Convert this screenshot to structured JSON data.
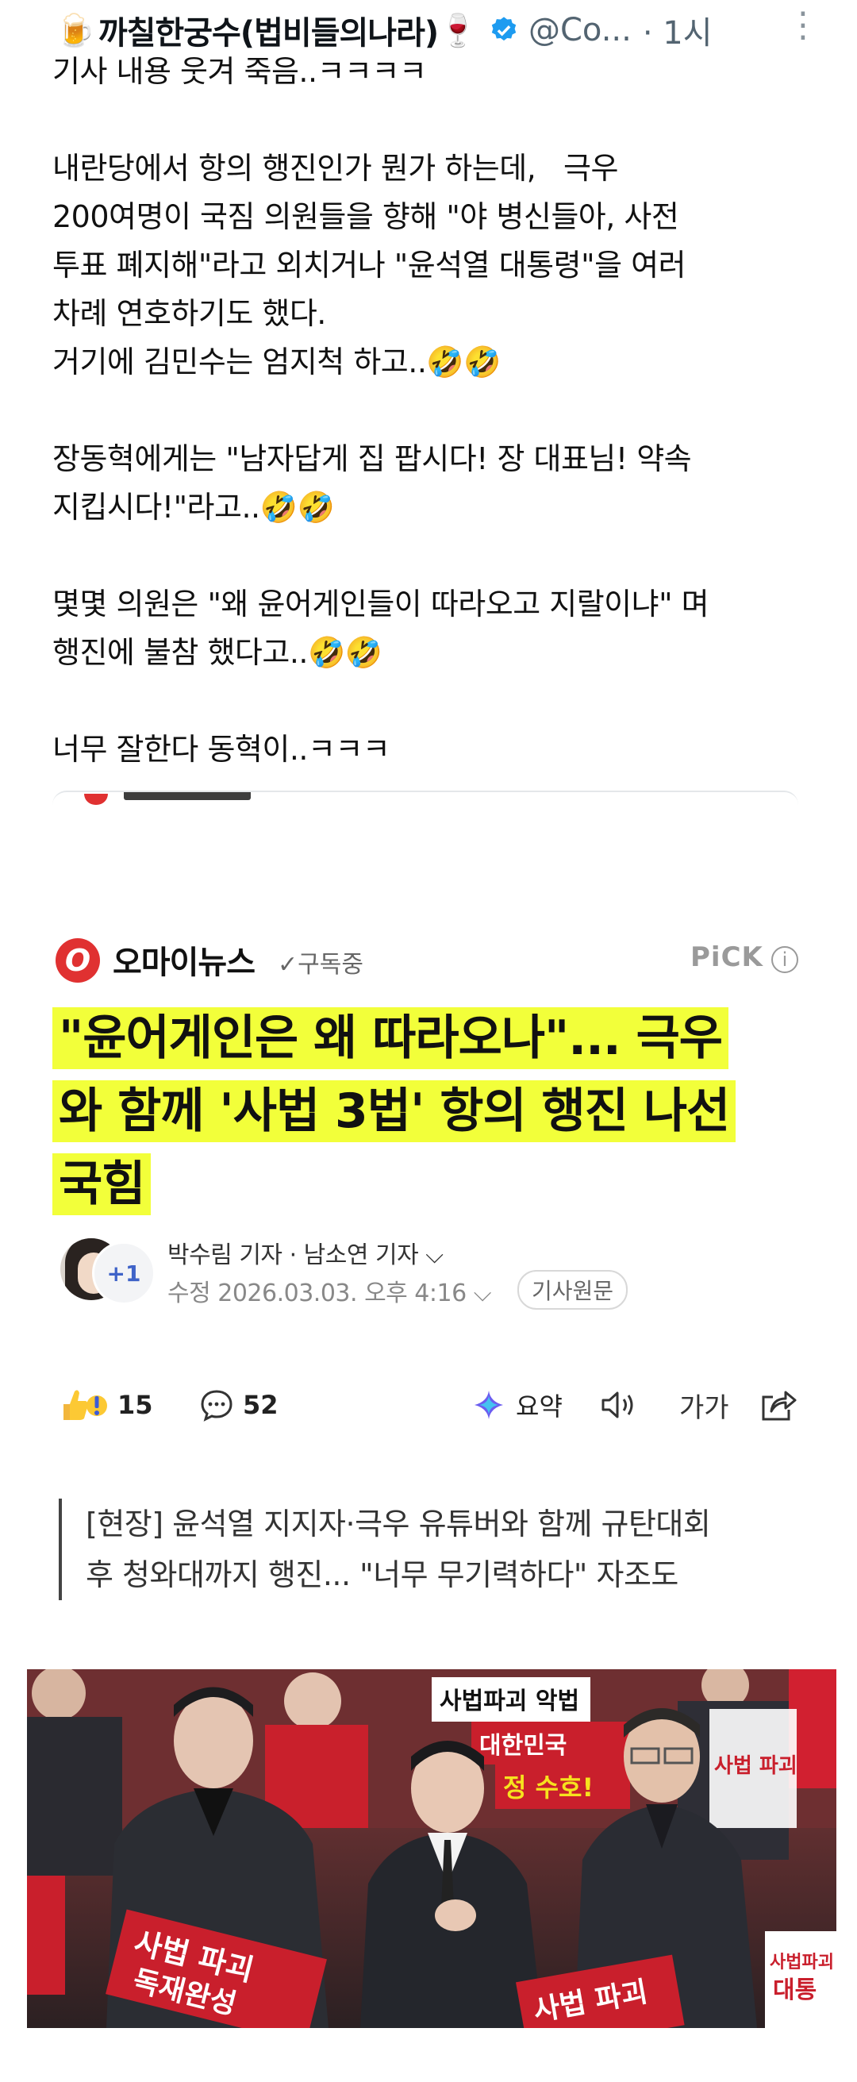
{
  "tweet": {
    "emoji_left": "🍺",
    "display_name": "까칠한궁수(법비들의나라)",
    "emoji_right": "🍷",
    "handle": "@Co...",
    "time": "· 1시",
    "more": "⋮",
    "body": [
      "기사 내용 웃겨 죽음..ㅋㅋㅋㅋ",
      "",
      "내란당에서 항의 행진인가 뭔가 하는데,   극우",
      "200여명이 국짐 의원들을 향해 \"야 병신들아, 사전",
      "투표 폐지해\"라고 외치거나 \"윤석열 대통령\"을 여러",
      "차례 연호하기도 했다.",
      "거기에 김민수는 엄지척 하고..🤣🤣",
      "",
      "장동혁에게는 \"남자답게 집 팝시다! 장 대표님! 약속",
      "지킵시다!\"라고..🤣🤣",
      "",
      "몇몇 의원은 \"왜 윤어게인들이 따라오고 지랄이냐\" 며",
      "행진에 불참 했다고..🤣🤣",
      "",
      "너무 잘한다 동혁이..ㅋㅋㅋ"
    ]
  },
  "article": {
    "press_logo": "O",
    "press_name": "오마이뉴스",
    "subscribe": "✓구독중",
    "pick": "PiCK",
    "info": "i",
    "title_lines": [
      "\"윤어게인은 왜 따라오나\"... 극우",
      "와 함께 '사법 3법' 항의 행진 나선",
      "국힘"
    ],
    "author_badge": "+1",
    "authors": "박수림 기자 · 남소연 기자 ⌵",
    "modified": "수정 2026.03.03. 오후 4:16 ⌵",
    "original_button": "기사원문",
    "reactions_count": "15",
    "comments_count": "52",
    "summary_label": "요약",
    "font_label": "가가",
    "subtitle_lines": [
      "[현장] 윤석열 지지자·극우 유튜버와 함께 규탄대회",
      "후 청와대까지 행진... \"너무 무기력하다\" 자조도"
    ]
  },
  "photo": {
    "signs": [
      "사법파괴 악법",
      "대한민국",
      "정 수호!",
      "사법 파괴",
      "독재완성",
      "사법파괴",
      "대통"
    ]
  },
  "colors": {
    "highlight": "#f2ff3a",
    "press_red": "#e03131",
    "verified_blue": "#1d9bf0",
    "sign_red": "#d3202b"
  }
}
